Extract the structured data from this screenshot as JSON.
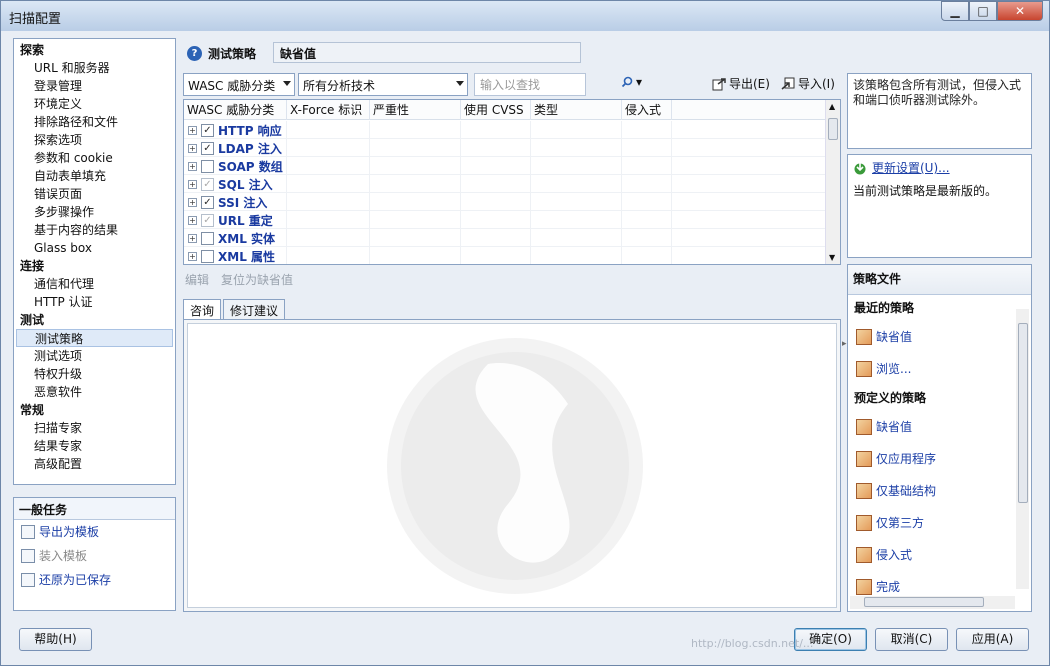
{
  "window": {
    "title": "扫描配置",
    "min": "▁",
    "max": "□",
    "close": "✕"
  },
  "nav": {
    "groups": [
      {
        "label": "探索",
        "items": [
          "URL 和服务器",
          "登录管理",
          "环境定义",
          "排除路径和文件",
          "探索选项",
          "参数和 cookie",
          "自动表单填充",
          "错误页面",
          "多步骤操作",
          "基于内容的结果",
          "Glass box"
        ]
      },
      {
        "label": "连接",
        "items": [
          "通信和代理",
          "HTTP 认证"
        ]
      },
      {
        "label": "测试",
        "items": [
          "测试策略",
          "测试选项",
          "特权升级",
          "恶意软件"
        ]
      },
      {
        "label": "常规",
        "items": [
          "扫描专家",
          "结果专家",
          "高级配置"
        ]
      }
    ],
    "selected": "测试策略"
  },
  "tasks": {
    "title": "一般任务",
    "items": [
      {
        "label": "导出为模板",
        "enabled": true
      },
      {
        "label": "装入模板",
        "enabled": false
      },
      {
        "label": "还原为已保存",
        "enabled": true
      }
    ]
  },
  "policy": {
    "label": "测试策略",
    "value": "缺省值"
  },
  "filters": {
    "category": "WASC 威胁分类",
    "tech": "所有分析技术",
    "search_placeholder": "输入以查找",
    "export": "导出(E)",
    "import": "导入(I)"
  },
  "grid": {
    "columns": [
      "WASC 威胁分类",
      "X-Force 标识",
      "严重性",
      "使用 CVSS",
      "类型",
      "侵入式"
    ],
    "rows": [
      {
        "label": "HTTP 响应",
        "checked": true,
        "gray": false
      },
      {
        "label": "LDAP 注入",
        "checked": true,
        "gray": false
      },
      {
        "label": "SOAP 数组",
        "checked": false,
        "gray": false
      },
      {
        "label": "SQL 注入",
        "checked": true,
        "gray": true
      },
      {
        "label": "SSI 注入",
        "checked": true,
        "gray": false
      },
      {
        "label": "URL 重定",
        "checked": true,
        "gray": true
      },
      {
        "label": "XML 实体",
        "checked": false,
        "gray": false
      },
      {
        "label": "XML 属性",
        "checked": false,
        "gray": false
      }
    ]
  },
  "actions": {
    "edit": "编辑",
    "reset": "复位为缺省值"
  },
  "tabs": [
    "咨询",
    "修订建议"
  ],
  "right": {
    "description": "该策略包含所有测试，但侵入式和端口侦听器测试除外。",
    "update_link": "更新设置(U)...",
    "update_status": "当前测试策略是最新版的。",
    "files_title": "策略文件",
    "recent_title": "最近的策略",
    "recent": [
      "缺省值",
      "浏览..."
    ],
    "predefined_title": "预定义的策略",
    "predefined": [
      "缺省值",
      "仅应用程序",
      "仅基础结构",
      "仅第三方",
      "侵入式",
      "完成"
    ]
  },
  "buttons": {
    "help": "帮助(H)",
    "ok": "确定(O)",
    "cancel": "取消(C)",
    "apply": "应用(A)"
  },
  "watermark": "http://blog.csdn.net/..."
}
